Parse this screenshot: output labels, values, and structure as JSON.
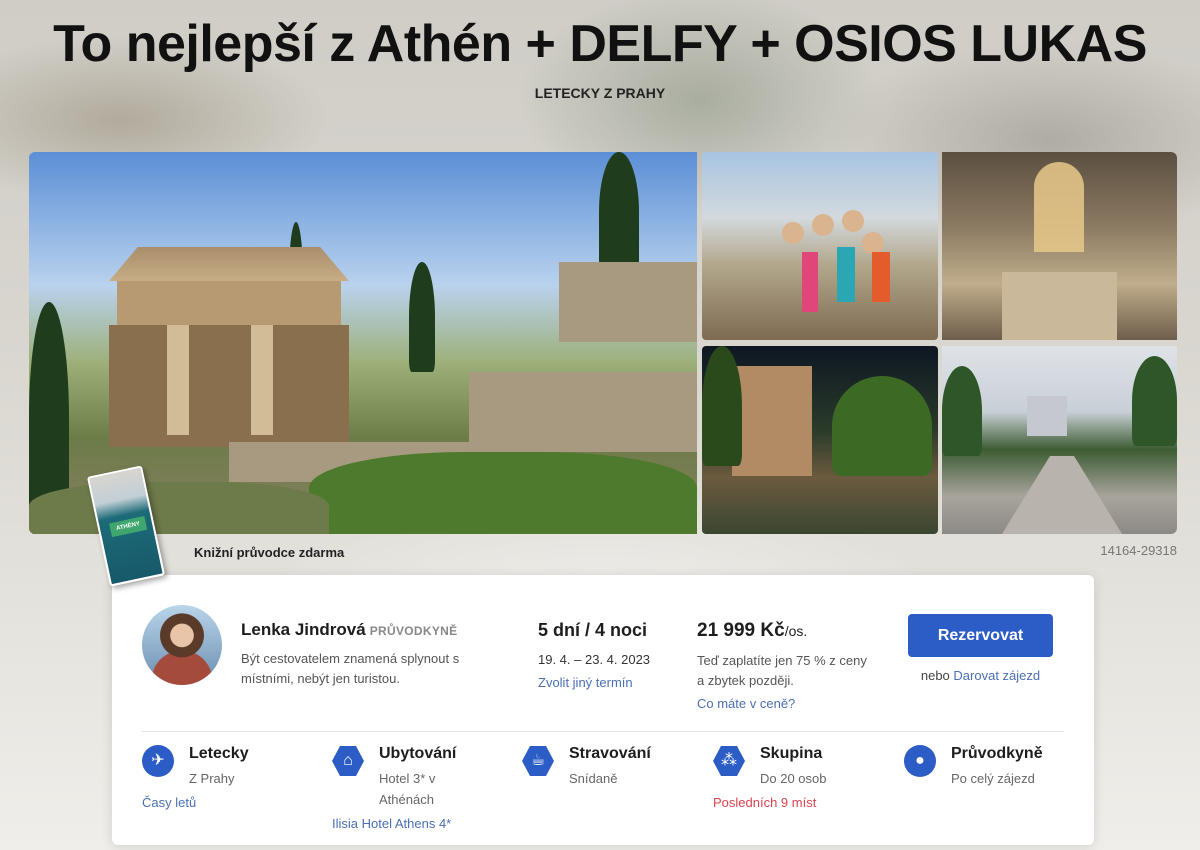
{
  "header": {
    "title": "To nejlepší z Athén + DELFY + OSIOS LUKAS",
    "subtitle": "LETECKY Z PRAHY"
  },
  "gallery": {
    "book_label": "ATHÉNY",
    "guide_book_text": "Knižní průvodce zdarma",
    "tour_code": "14164-29318"
  },
  "guide": {
    "name": "Lenka Jindrová",
    "role": "PRŮVODKYNĚ",
    "quote": "Být cestovatelem znamená splynout s místními, nebýt jen turistou."
  },
  "term": {
    "duration": "5 dní / 4 noci",
    "dates": "19. 4. – 23. 4. 2023",
    "other_date_link": "Zvolit jiný termín"
  },
  "price": {
    "amount": "21 999 Kč",
    "unit": "/os.",
    "note": "Teď zaplatíte jen 75 % z ceny a zbytek později.",
    "link": "Co máte v ceně?"
  },
  "booking": {
    "button": "Rezervovat",
    "or_text": "nebo",
    "gift_link": "Darovat zájezd"
  },
  "features": {
    "flight": {
      "icon": "airplane-icon",
      "title": "Letecky",
      "sub": "Z Prahy",
      "link": "Časy letů"
    },
    "stay": {
      "icon": "house-icon",
      "title": "Ubytování",
      "sub": "Hotel 3* v Athénách",
      "link": "Ilisia Hotel Athens 4*"
    },
    "food": {
      "icon": "cup-icon",
      "title": "Stravování",
      "sub": "Snídaně"
    },
    "group": {
      "icon": "group-icon",
      "title": "Skupina",
      "sub": "Do 20 osob",
      "alert": "Posledních 9 míst"
    },
    "guide": {
      "icon": "person-icon",
      "title": "Průvodkyně",
      "sub": "Po celý zájezd"
    }
  },
  "colors": {
    "accent": "#2c5cc5",
    "link": "#4a6fb3",
    "alert": "#d9434f"
  }
}
